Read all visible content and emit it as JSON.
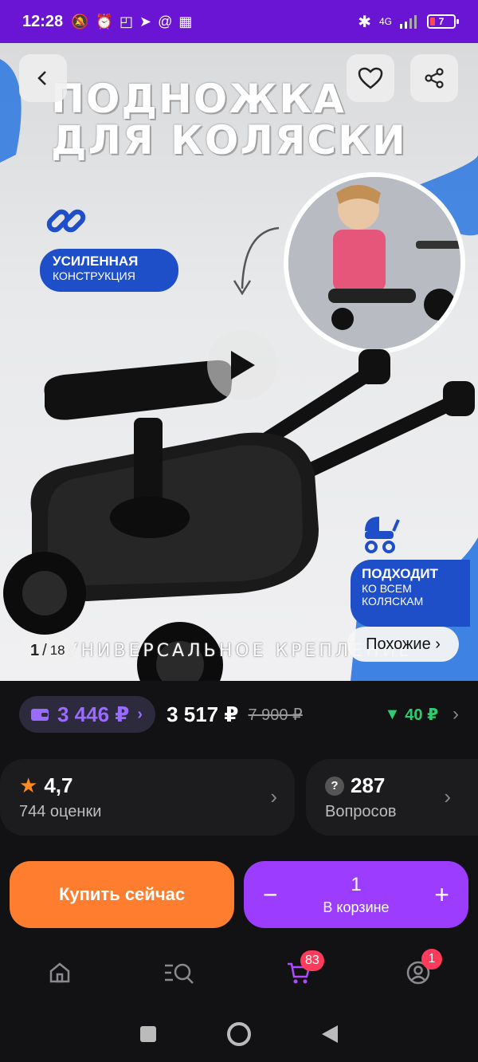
{
  "status_bar": {
    "time": "12:28",
    "network": "4G",
    "battery": "7"
  },
  "product_gallery": {
    "title_line1": "ПОДНОЖКА",
    "title_line2": "ДЛЯ КОЛЯСКИ",
    "badge_left_line1": "УСИЛЕННАЯ",
    "badge_left_line2": "КОНСТРУКЦИЯ",
    "badge_right_line1": "ПОДХОДИТ",
    "badge_right_line2": "КО ВСЕМ",
    "badge_right_line3": "КОЛЯСКАМ",
    "caption": "УНИВЕРСАЛЬНОЕ КРЕПЛЕНИЕ",
    "counter_current": "1",
    "counter_total": "18",
    "similar_label": "Похожие ›"
  },
  "price": {
    "wallet_price": "3 446 ₽",
    "price": "3 517 ₽",
    "old_price": "7 900 ₽",
    "cashback": "40 ₽"
  },
  "rating": {
    "value": "4,7",
    "count_label": "744 оценки"
  },
  "questions": {
    "count": "287",
    "label": "Вопросов"
  },
  "actions": {
    "buy_label": "Купить сейчас",
    "cart_quantity": "1",
    "cart_label": "В корзине"
  },
  "bottom_nav": {
    "cart_badge": "83",
    "profile_badge": "1"
  },
  "colors": {
    "accent_purple": "#9c3cff",
    "buy_orange": "#ff7d2e",
    "status_bar": "#6a14d4",
    "cashback_green": "#2ecc71"
  }
}
